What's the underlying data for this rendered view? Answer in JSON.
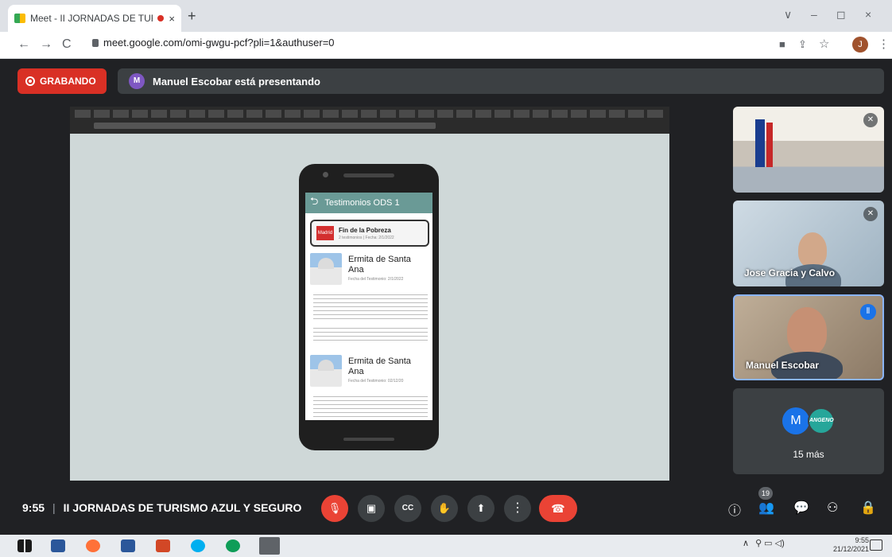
{
  "browser": {
    "tab_title": "Meet - II JORNADAS DE TUR",
    "tab_close": "×",
    "new_tab": "+",
    "url_host": "meet.google.com",
    "url_path": "/omi-gwgu-pcf?pli=1&authuser=0",
    "profile_initial": "J",
    "back": "←",
    "forward": "→",
    "reload": "C",
    "win_minimize": "–",
    "win_restore": "◻",
    "win_close": "×",
    "chevron": "∨",
    "cam_icon": "■",
    "share_icon": "⇪",
    "star_icon": "☆",
    "menu_icon": "⋮"
  },
  "meet": {
    "recording_label": "GRABANDO",
    "presenter_initial": "M",
    "presenting_text": "Manuel Escobar está presentando",
    "meeting_time": "9:55",
    "meeting_separator": "|",
    "meeting_title": "II JORNADAS DE TURISMO AZUL Y SEGURO",
    "people_count": "19",
    "more_count_label": "15 más",
    "more_avatar_initial": "M",
    "more_avatar2_text": "ANGENO"
  },
  "shared_app": {
    "header_title": "Testimonios ODS 1",
    "back_glyph": "⮌",
    "card_title": "Fin de la Pobreza",
    "card_subtitle": "2 testimonios | Fecha: 2/1/2022",
    "card_logo": "Madrid",
    "entries": [
      {
        "title": "Ermita de Santa Ana",
        "date": "Fecha del Testimonio: 2/1/2022"
      },
      {
        "title": "Ermita de Santa Ana",
        "date": "Fecha del Testimonio: 02/12/20"
      }
    ]
  },
  "participants": [
    {
      "name": ""
    },
    {
      "name": "Jose Gracia y Calvo"
    },
    {
      "name": "Manuel Escobar"
    }
  ],
  "controls": {
    "mic": "🎙",
    "camera": "▣",
    "captions": "CC",
    "hand": "✋",
    "present": "⬆",
    "more": "⋮",
    "hangup": "☎",
    "info": "ⓘ",
    "people": "👥",
    "chat": "💬",
    "activities": "⚇",
    "security": "🔒"
  },
  "taskbar": {
    "tray_up": "∧",
    "tray_icons": "⚲ ▭ ◁)",
    "clock_time": "9:55",
    "clock_date": "21/12/2021"
  },
  "colors": {
    "recording_red": "#d93025",
    "hangup_red": "#ea4335",
    "meet_bg": "#202124",
    "active_border": "#8ab4f8"
  }
}
